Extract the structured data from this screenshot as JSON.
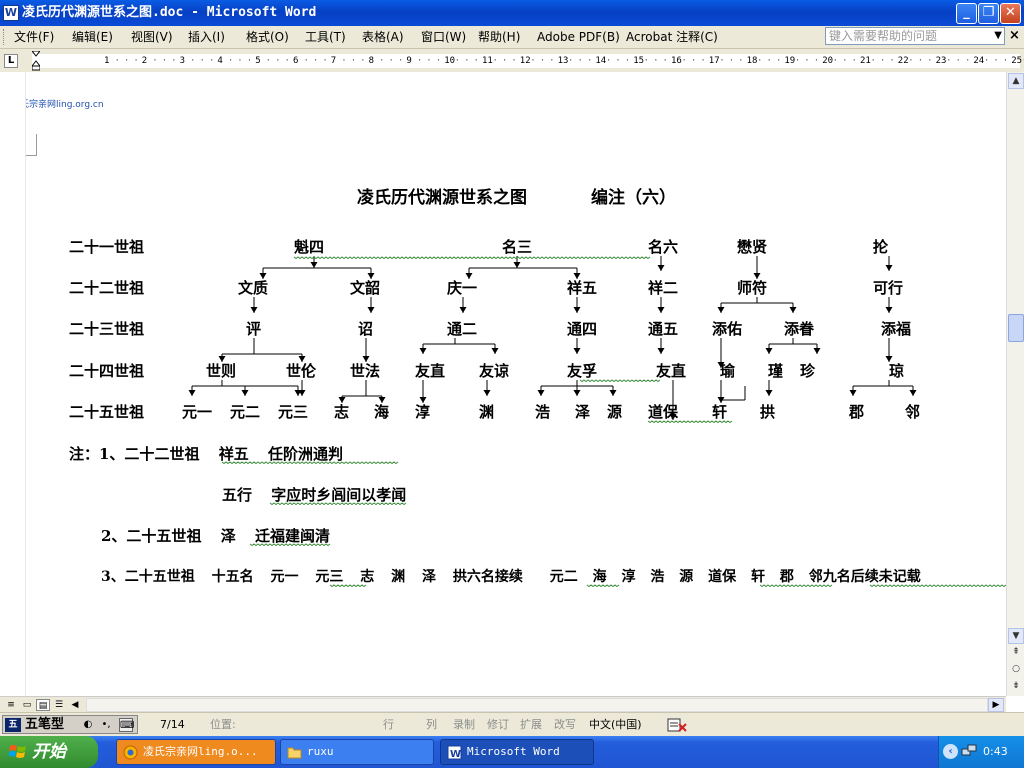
{
  "window": {
    "title": "凌氏历代渊源世系之图.doc - Microsoft Word",
    "app_icon": "W",
    "buttons": {
      "minimize": "_",
      "restore": "❐",
      "close": "✕"
    }
  },
  "menu": {
    "items": [
      "文件(F)",
      "编辑(E)",
      "视图(V)",
      "插入(I)",
      "格式(O)",
      "工具(T)",
      "表格(A)",
      "窗口(W)",
      "帮助(H)",
      "Adobe PDF(B)",
      "Acrobat 注释(C)"
    ],
    "help_placeholder": "键入需要帮助的问题",
    "close_doc": "×"
  },
  "ruler": {
    "tab_selector": "L",
    "numbers": [
      "1",
      "2",
      "3",
      "4",
      "5",
      "6",
      "7",
      "8",
      "9",
      "10",
      "11",
      "12",
      "13",
      "14",
      "15",
      "16",
      "17",
      "18",
      "19",
      "20",
      "21",
      "22",
      "23",
      "24",
      "25"
    ]
  },
  "document": {
    "header": "凌氏宗亲网ling.org.cn",
    "title": "凌氏历代渊源世系之图",
    "subtitle": "编注（六）",
    "generations": [
      "二十一世祖",
      "二十二世祖",
      "二十三世祖",
      "二十四世祖",
      "二十五世祖"
    ],
    "gen21": [
      "魁四",
      "名三",
      "名六",
      "懋贤",
      "抡"
    ],
    "gen22": [
      "文质",
      "文韶",
      "庆一",
      "祥五",
      "祥二",
      "师符",
      "可行"
    ],
    "gen23": [
      "评",
      "诏",
      "通二",
      "通四",
      "通五",
      "添佑",
      "添眷",
      "添福"
    ],
    "gen24": [
      "世则",
      "世伦",
      "世法",
      "友直",
      "友谅",
      "友孚",
      "友直",
      "瑜",
      "瑾",
      "珍",
      "琼"
    ],
    "gen25": [
      "元一",
      "元二",
      "元三",
      "志",
      "海",
      "淳",
      "渊",
      "浩",
      "泽",
      "源",
      "道保",
      "轩",
      "拱",
      "郡",
      "邻"
    ],
    "notes": {
      "n1_prefix": "注：1、二十二世祖",
      "n1_name": "祥五",
      "n1_text": "任阶洲通判",
      "n1b_name": "五行",
      "n1b_text": "字应时乡闾间以孝闻",
      "n2_prefix": "2、二十五世祖",
      "n2_name": "泽",
      "n2_text": "迁福建闽清",
      "n3_prefix": "3、二十五世祖",
      "n3_count": "十五名",
      "n3_names_a": [
        "元一",
        "元三",
        "志",
        "渊",
        "泽"
      ],
      "n3_mid": "拱六名接续",
      "n3_names_b": [
        "元二",
        "海",
        "淳",
        "浩",
        "源",
        "道保",
        "轩",
        "郡"
      ],
      "n3_end": "邻九名后续未记载"
    }
  },
  "statusbar": {
    "ime_name": "五笔型",
    "page": "7/14",
    "position": "位置:",
    "line": "行",
    "col": "列",
    "rec": "录制",
    "trk": "修订",
    "ext": "扩展",
    "ovr": "改写",
    "language": "中文(中国)"
  },
  "taskbar": {
    "start": "开始",
    "buttons": [
      "凌氏宗亲网ling.o...",
      "ruxu",
      "Microsoft Word"
    ],
    "clock": "0:43"
  }
}
